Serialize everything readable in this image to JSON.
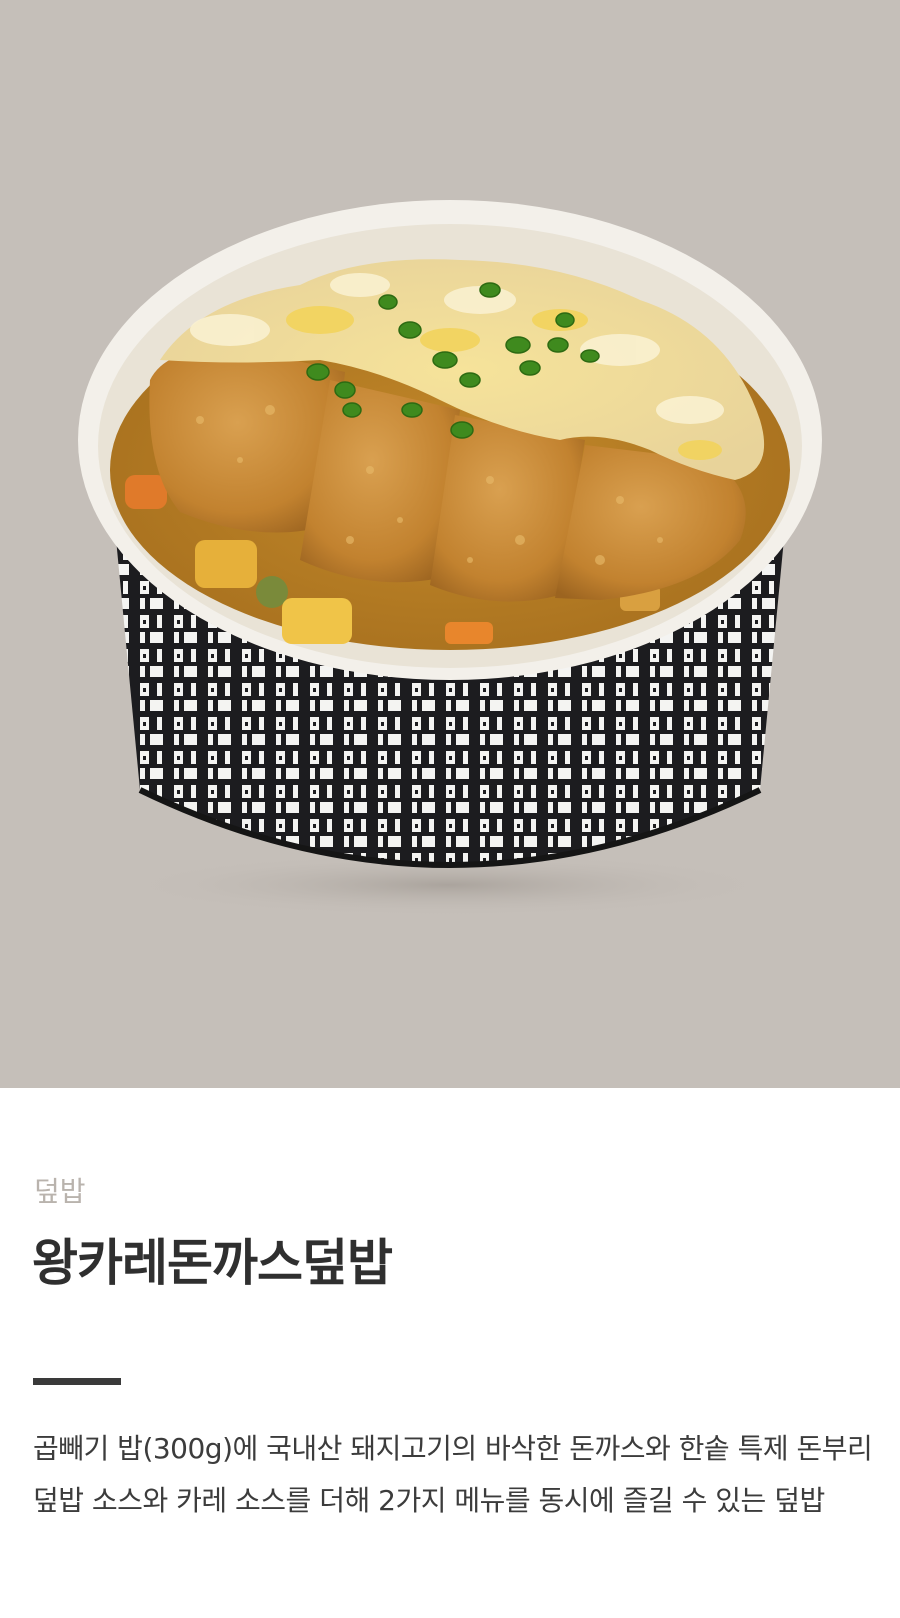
{
  "product": {
    "category": "덮밥",
    "name": "왕카레돈까스덮밥",
    "description": "곱빼기 밥(300g)에 국내산 돼지고기의 바삭한 돈까스와 한솥 특제 돈부리 덮밥 소스와 카레 소스를 더해 2가지 메뉴를 동시에 즐길 수 있는 덮밥"
  },
  "colors": {
    "hero_background": "#c5bfb9",
    "category_text": "#b9b3ad",
    "title_text": "#2f2f2f",
    "divider": "#3a3a3a"
  }
}
